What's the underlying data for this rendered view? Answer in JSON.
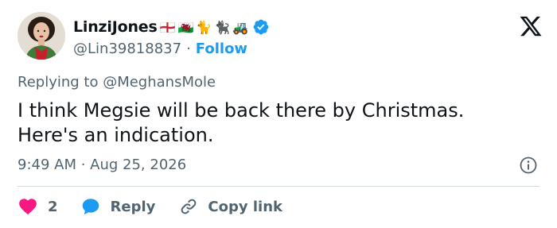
{
  "colors": {
    "accent": "#1d9bf0",
    "text_primary": "#0f1419",
    "text_secondary": "#536471",
    "like": "#f91880",
    "divider": "#cfd9de"
  },
  "author": {
    "display_name": "LinziJones",
    "name_emojis": [
      "🏴󠁧󠁢󠁥󠁮󠁧󠁿",
      "🏴󠁧󠁢󠁷󠁬󠁳󠁿",
      "🐈",
      "🐈‍⬛",
      "🚜"
    ],
    "handle": "@Lin39818837",
    "separator": "·",
    "follow_label": "Follow",
    "verified_icon": "verified-badge-icon",
    "avatar_icon": "avatar"
  },
  "tweet": {
    "replying_to": "Replying to @MeghansMole",
    "text_lines": [
      "I think Megsie will be back there by Christmas.",
      "Here's an indication."
    ],
    "meta": "9:49 AM · Aug 25, 2026"
  },
  "actions": {
    "like_count": "2",
    "reply_label": "Reply",
    "copy_link_label": "Copy link"
  },
  "icons": {
    "brand": "x-logo-icon",
    "info": "info-icon",
    "like": "heart-icon",
    "reply": "reply-bubble-icon",
    "copy": "link-icon"
  }
}
